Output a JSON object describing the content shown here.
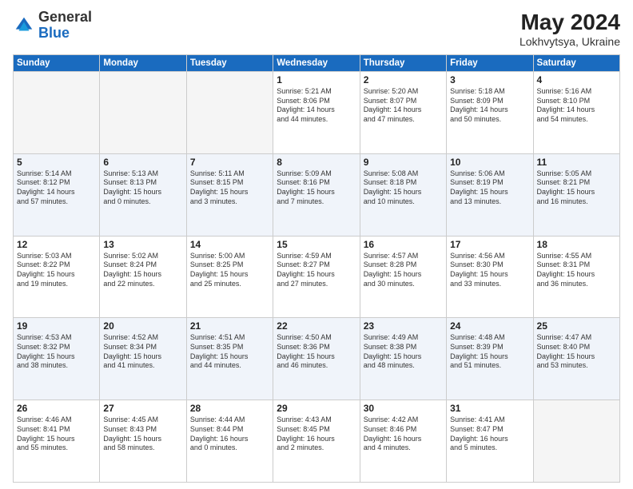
{
  "header": {
    "logo_general": "General",
    "logo_blue": "Blue",
    "month_title": "May 2024",
    "location": "Lokhvytsya, Ukraine"
  },
  "weekdays": [
    "Sunday",
    "Monday",
    "Tuesday",
    "Wednesday",
    "Thursday",
    "Friday",
    "Saturday"
  ],
  "weeks": [
    [
      {
        "day": "",
        "info": ""
      },
      {
        "day": "",
        "info": ""
      },
      {
        "day": "",
        "info": ""
      },
      {
        "day": "1",
        "info": "Sunrise: 5:21 AM\nSunset: 8:06 PM\nDaylight: 14 hours\nand 44 minutes."
      },
      {
        "day": "2",
        "info": "Sunrise: 5:20 AM\nSunset: 8:07 PM\nDaylight: 14 hours\nand 47 minutes."
      },
      {
        "day": "3",
        "info": "Sunrise: 5:18 AM\nSunset: 8:09 PM\nDaylight: 14 hours\nand 50 minutes."
      },
      {
        "day": "4",
        "info": "Sunrise: 5:16 AM\nSunset: 8:10 PM\nDaylight: 14 hours\nand 54 minutes."
      }
    ],
    [
      {
        "day": "5",
        "info": "Sunrise: 5:14 AM\nSunset: 8:12 PM\nDaylight: 14 hours\nand 57 minutes."
      },
      {
        "day": "6",
        "info": "Sunrise: 5:13 AM\nSunset: 8:13 PM\nDaylight: 15 hours\nand 0 minutes."
      },
      {
        "day": "7",
        "info": "Sunrise: 5:11 AM\nSunset: 8:15 PM\nDaylight: 15 hours\nand 3 minutes."
      },
      {
        "day": "8",
        "info": "Sunrise: 5:09 AM\nSunset: 8:16 PM\nDaylight: 15 hours\nand 7 minutes."
      },
      {
        "day": "9",
        "info": "Sunrise: 5:08 AM\nSunset: 8:18 PM\nDaylight: 15 hours\nand 10 minutes."
      },
      {
        "day": "10",
        "info": "Sunrise: 5:06 AM\nSunset: 8:19 PM\nDaylight: 15 hours\nand 13 minutes."
      },
      {
        "day": "11",
        "info": "Sunrise: 5:05 AM\nSunset: 8:21 PM\nDaylight: 15 hours\nand 16 minutes."
      }
    ],
    [
      {
        "day": "12",
        "info": "Sunrise: 5:03 AM\nSunset: 8:22 PM\nDaylight: 15 hours\nand 19 minutes."
      },
      {
        "day": "13",
        "info": "Sunrise: 5:02 AM\nSunset: 8:24 PM\nDaylight: 15 hours\nand 22 minutes."
      },
      {
        "day": "14",
        "info": "Sunrise: 5:00 AM\nSunset: 8:25 PM\nDaylight: 15 hours\nand 25 minutes."
      },
      {
        "day": "15",
        "info": "Sunrise: 4:59 AM\nSunset: 8:27 PM\nDaylight: 15 hours\nand 27 minutes."
      },
      {
        "day": "16",
        "info": "Sunrise: 4:57 AM\nSunset: 8:28 PM\nDaylight: 15 hours\nand 30 minutes."
      },
      {
        "day": "17",
        "info": "Sunrise: 4:56 AM\nSunset: 8:30 PM\nDaylight: 15 hours\nand 33 minutes."
      },
      {
        "day": "18",
        "info": "Sunrise: 4:55 AM\nSunset: 8:31 PM\nDaylight: 15 hours\nand 36 minutes."
      }
    ],
    [
      {
        "day": "19",
        "info": "Sunrise: 4:53 AM\nSunset: 8:32 PM\nDaylight: 15 hours\nand 38 minutes."
      },
      {
        "day": "20",
        "info": "Sunrise: 4:52 AM\nSunset: 8:34 PM\nDaylight: 15 hours\nand 41 minutes."
      },
      {
        "day": "21",
        "info": "Sunrise: 4:51 AM\nSunset: 8:35 PM\nDaylight: 15 hours\nand 44 minutes."
      },
      {
        "day": "22",
        "info": "Sunrise: 4:50 AM\nSunset: 8:36 PM\nDaylight: 15 hours\nand 46 minutes."
      },
      {
        "day": "23",
        "info": "Sunrise: 4:49 AM\nSunset: 8:38 PM\nDaylight: 15 hours\nand 48 minutes."
      },
      {
        "day": "24",
        "info": "Sunrise: 4:48 AM\nSunset: 8:39 PM\nDaylight: 15 hours\nand 51 minutes."
      },
      {
        "day": "25",
        "info": "Sunrise: 4:47 AM\nSunset: 8:40 PM\nDaylight: 15 hours\nand 53 minutes."
      }
    ],
    [
      {
        "day": "26",
        "info": "Sunrise: 4:46 AM\nSunset: 8:41 PM\nDaylight: 15 hours\nand 55 minutes."
      },
      {
        "day": "27",
        "info": "Sunrise: 4:45 AM\nSunset: 8:43 PM\nDaylight: 15 hours\nand 58 minutes."
      },
      {
        "day": "28",
        "info": "Sunrise: 4:44 AM\nSunset: 8:44 PM\nDaylight: 16 hours\nand 0 minutes."
      },
      {
        "day": "29",
        "info": "Sunrise: 4:43 AM\nSunset: 8:45 PM\nDaylight: 16 hours\nand 2 minutes."
      },
      {
        "day": "30",
        "info": "Sunrise: 4:42 AM\nSunset: 8:46 PM\nDaylight: 16 hours\nand 4 minutes."
      },
      {
        "day": "31",
        "info": "Sunrise: 4:41 AM\nSunset: 8:47 PM\nDaylight: 16 hours\nand 5 minutes."
      },
      {
        "day": "",
        "info": ""
      }
    ]
  ]
}
